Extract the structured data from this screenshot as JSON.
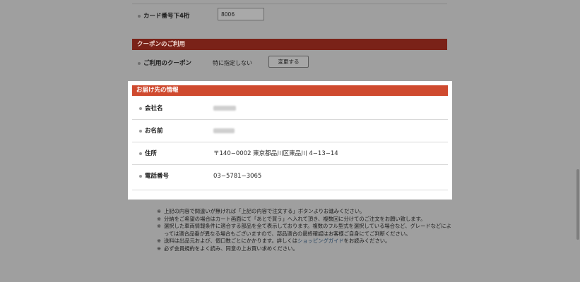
{
  "card_last4": {
    "label": "カード番号下4桁",
    "value": "8006"
  },
  "coupon": {
    "header": "クーポンのご利用",
    "label": "ご利用のクーポン",
    "value": "特に指定しない",
    "change_button": "変更する"
  },
  "shipping": {
    "header": "お届け先の情報",
    "rows": [
      {
        "label": "会社名",
        "value": ""
      },
      {
        "label": "お名前",
        "value": ""
      },
      {
        "label": "住所",
        "value": "〒140−0002 東京都品川区東品川 4−13−14"
      },
      {
        "label": "電話番号",
        "value": "03−5781−3065"
      }
    ]
  },
  "notes": [
    {
      "text": "上記の内容で間違いが無ければ「上記の内容で注文する」ボタンよりお進みください。"
    },
    {
      "text": "分納をご希望の場合はカート画面にて「あとで買う」へ入れて頂き、複数回に分けてのご注文をお願い致します。"
    },
    {
      "text": "選択した車両情報条件に適合する部品を全て表示しております。複数のフル型式を選択している場合など、グレードなどによっては適合品番が異なる場合もございますので、部品適合の最終確認はお客様ご自身にてご判断ください。"
    },
    {
      "text_before": "送料は出品元および、個口数ごとにかかります。詳しくは",
      "link": "ショッピングガイド",
      "text_after": "をお読みください。"
    },
    {
      "text": "必ず会員規約をよく読み、同意の上お買い求めください。"
    }
  ],
  "asterisk": "※"
}
